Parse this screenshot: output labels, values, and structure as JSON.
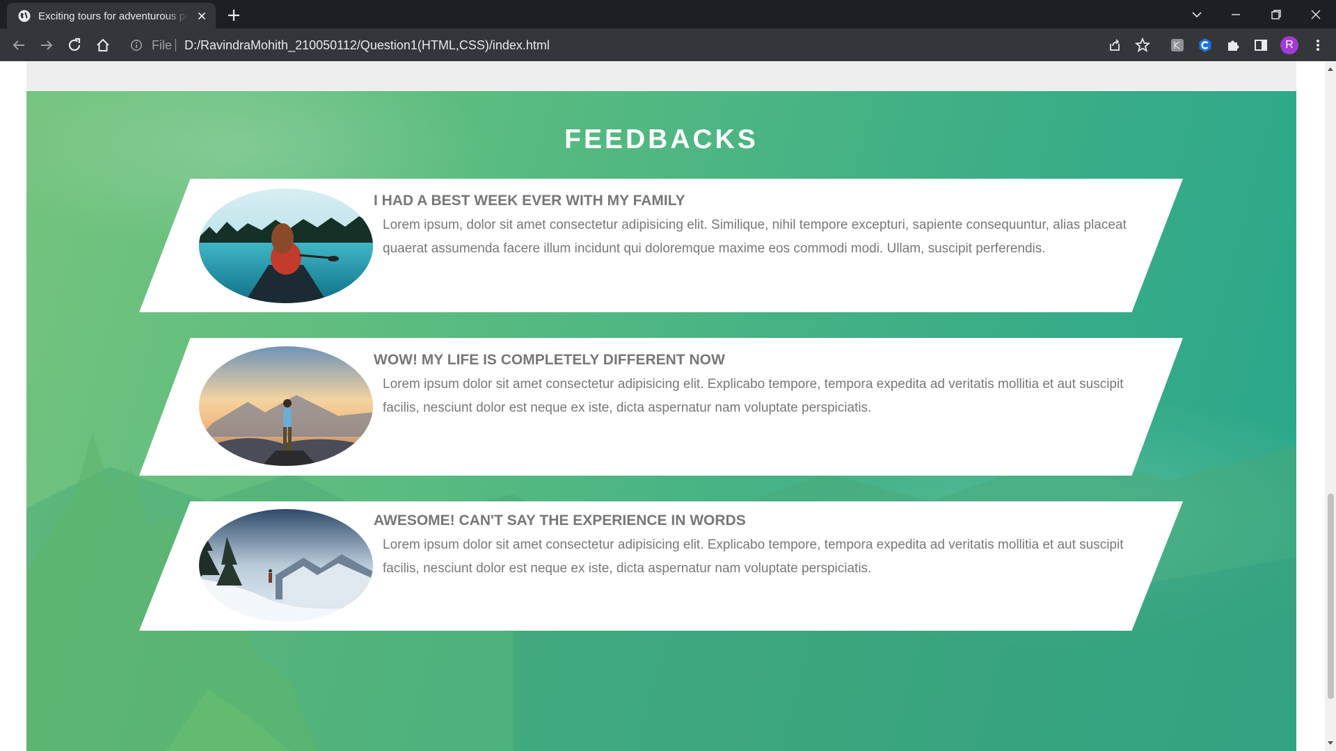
{
  "browser": {
    "tab_title": "Exciting tours for adventurous people",
    "address_scheme_label": "File",
    "address_url": "D:/RavindraMohith_210050112/Question1(HTML,CSS)/index.html",
    "profile_initial": "R"
  },
  "section": {
    "title": "FEEDBACKS",
    "accent_colors": [
      "#7ec67a",
      "#28a68b"
    ]
  },
  "feedbacks": [
    {
      "headline": "I had a best week ever with my family",
      "text": "Lorem ipsum, dolor sit amet consectetur adipisicing elit. Similique, nihil tempore excepturi, sapiente consequuntur, alias placeat quaerat assumenda facere illum incidunt qui doloremque maxime eos commodi modi. Ullam, suscipit perferendis.",
      "photo_icon": "woman-in-canoe-lake-photo"
    },
    {
      "headline": "WOW! my life is completely different now",
      "text": "Lorem ipsum dolor sit amet consectetur adipisicing elit. Explicabo tempore, tempora expedita ad veritatis mollitia et aut suscipit facilis, nesciunt dolor est neque ex iste, dicta aspernatur nam voluptate perspiciatis.",
      "photo_icon": "man-on-mountain-sunrise-photo"
    },
    {
      "headline": "Awesome! can't say the experience in words",
      "text": "Lorem ipsum dolor sit amet consectetur adipisicing elit. Explicabo tempore, tempora expedita ad veritatis mollitia et aut suscipit facilis, nesciunt dolor est neque ex iste, dicta aspernatur nam voluptate perspiciatis.",
      "photo_icon": "snowy-mountain-hiker-photo"
    }
  ]
}
